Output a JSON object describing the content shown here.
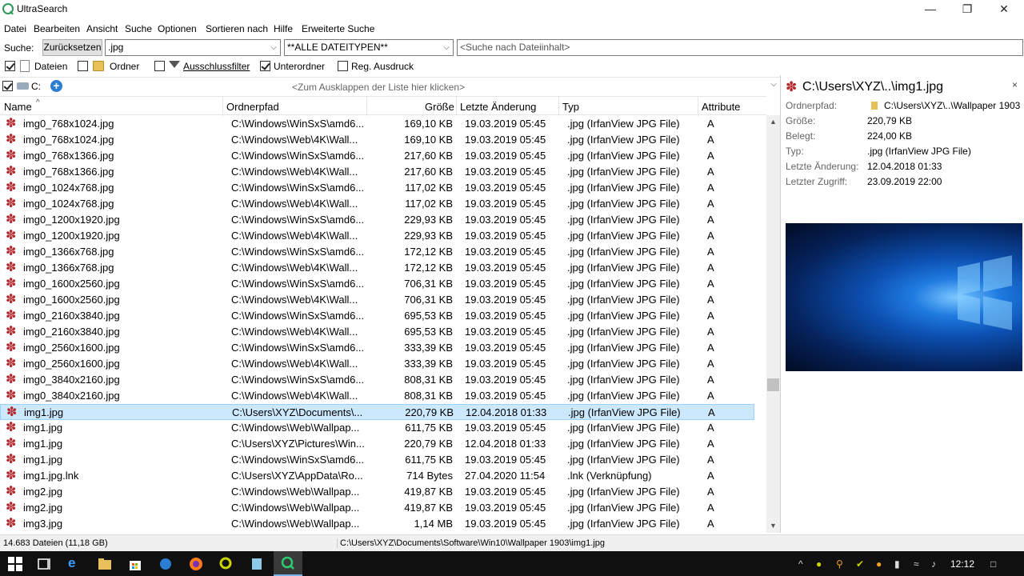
{
  "app": {
    "title": "UltraSearch"
  },
  "window_controls": {
    "minimize": "—",
    "maximize": "❐",
    "close": "✕"
  },
  "menu": [
    "Datei",
    "Bearbeiten",
    "Ansicht",
    "Suche",
    "Optionen",
    "Sortieren nach",
    "Hilfe",
    "Erweiterte Suche"
  ],
  "search": {
    "label": "Suche:",
    "reset_label": "Zurücksetzen",
    "query": ".jpg",
    "filetype": "**ALLE DATEITYPEN**",
    "content_placeholder": "<Suche nach Dateiinhalt>"
  },
  "options": {
    "files": {
      "label": "Dateien",
      "checked": true
    },
    "folders": {
      "label": "Ordner",
      "checked": false
    },
    "exclusion": {
      "label": "Ausschlussfilter",
      "checked": false
    },
    "subfolders": {
      "label": "Unterordner",
      "checked": true
    },
    "regex": {
      "label": "Reg. Ausdruck",
      "checked": false
    }
  },
  "drive": {
    "label": "C:",
    "expand_hint": "<Zum Ausklappen der Liste hier klicken>"
  },
  "columns": {
    "name": "Name",
    "path": "Ordnerpfad",
    "size": "Größe",
    "modified": "Letzte Änderung",
    "type": "Typ",
    "attributes": "Attribute"
  },
  "rows": [
    {
      "name": "img0_768x1024.jpg",
      "path": "C:\\Windows\\WinSxS\\amd6...",
      "size": "169,10 KB",
      "modified": "19.03.2019 05:45",
      "type": ".jpg (IrfanView JPG File)",
      "attr": "A"
    },
    {
      "name": "img0_768x1024.jpg",
      "path": "C:\\Windows\\Web\\4K\\Wall...",
      "size": "169,10 KB",
      "modified": "19.03.2019 05:45",
      "type": ".jpg (IrfanView JPG File)",
      "attr": "A"
    },
    {
      "name": "img0_768x1366.jpg",
      "path": "C:\\Windows\\WinSxS\\amd6...",
      "size": "217,60 KB",
      "modified": "19.03.2019 05:45",
      "type": ".jpg (IrfanView JPG File)",
      "attr": "A"
    },
    {
      "name": "img0_768x1366.jpg",
      "path": "C:\\Windows\\Web\\4K\\Wall...",
      "size": "217,60 KB",
      "modified": "19.03.2019 05:45",
      "type": ".jpg (IrfanView JPG File)",
      "attr": "A"
    },
    {
      "name": "img0_1024x768.jpg",
      "path": "C:\\Windows\\WinSxS\\amd6...",
      "size": "117,02 KB",
      "modified": "19.03.2019 05:45",
      "type": ".jpg (IrfanView JPG File)",
      "attr": "A"
    },
    {
      "name": "img0_1024x768.jpg",
      "path": "C:\\Windows\\Web\\4K\\Wall...",
      "size": "117,02 KB",
      "modified": "19.03.2019 05:45",
      "type": ".jpg (IrfanView JPG File)",
      "attr": "A"
    },
    {
      "name": "img0_1200x1920.jpg",
      "path": "C:\\Windows\\WinSxS\\amd6...",
      "size": "229,93 KB",
      "modified": "19.03.2019 05:45",
      "type": ".jpg (IrfanView JPG File)",
      "attr": "A"
    },
    {
      "name": "img0_1200x1920.jpg",
      "path": "C:\\Windows\\Web\\4K\\Wall...",
      "size": "229,93 KB",
      "modified": "19.03.2019 05:45",
      "type": ".jpg (IrfanView JPG File)",
      "attr": "A"
    },
    {
      "name": "img0_1366x768.jpg",
      "path": "C:\\Windows\\WinSxS\\amd6...",
      "size": "172,12 KB",
      "modified": "19.03.2019 05:45",
      "type": ".jpg (IrfanView JPG File)",
      "attr": "A"
    },
    {
      "name": "img0_1366x768.jpg",
      "path": "C:\\Windows\\Web\\4K\\Wall...",
      "size": "172,12 KB",
      "modified": "19.03.2019 05:45",
      "type": ".jpg (IrfanView JPG File)",
      "attr": "A"
    },
    {
      "name": "img0_1600x2560.jpg",
      "path": "C:\\Windows\\WinSxS\\amd6...",
      "size": "706,31 KB",
      "modified": "19.03.2019 05:45",
      "type": ".jpg (IrfanView JPG File)",
      "attr": "A"
    },
    {
      "name": "img0_1600x2560.jpg",
      "path": "C:\\Windows\\Web\\4K\\Wall...",
      "size": "706,31 KB",
      "modified": "19.03.2019 05:45",
      "type": ".jpg (IrfanView JPG File)",
      "attr": "A"
    },
    {
      "name": "img0_2160x3840.jpg",
      "path": "C:\\Windows\\WinSxS\\amd6...",
      "size": "695,53 KB",
      "modified": "19.03.2019 05:45",
      "type": ".jpg (IrfanView JPG File)",
      "attr": "A"
    },
    {
      "name": "img0_2160x3840.jpg",
      "path": "C:\\Windows\\Web\\4K\\Wall...",
      "size": "695,53 KB",
      "modified": "19.03.2019 05:45",
      "type": ".jpg (IrfanView JPG File)",
      "attr": "A"
    },
    {
      "name": "img0_2560x1600.jpg",
      "path": "C:\\Windows\\WinSxS\\amd6...",
      "size": "333,39 KB",
      "modified": "19.03.2019 05:45",
      "type": ".jpg (IrfanView JPG File)",
      "attr": "A"
    },
    {
      "name": "img0_2560x1600.jpg",
      "path": "C:\\Windows\\Web\\4K\\Wall...",
      "size": "333,39 KB",
      "modified": "19.03.2019 05:45",
      "type": ".jpg (IrfanView JPG File)",
      "attr": "A"
    },
    {
      "name": "img0_3840x2160.jpg",
      "path": "C:\\Windows\\WinSxS\\amd6...",
      "size": "808,31 KB",
      "modified": "19.03.2019 05:45",
      "type": ".jpg (IrfanView JPG File)",
      "attr": "A"
    },
    {
      "name": "img0_3840x2160.jpg",
      "path": "C:\\Windows\\Web\\4K\\Wall...",
      "size": "808,31 KB",
      "modified": "19.03.2019 05:45",
      "type": ".jpg (IrfanView JPG File)",
      "attr": "A"
    },
    {
      "name": "img1.jpg",
      "path": "C:\\Users\\XYZ\\Documents\\...",
      "size": "220,79 KB",
      "modified": "12.04.2018 01:33",
      "type": ".jpg (IrfanView JPG File)",
      "attr": "A",
      "selected": true
    },
    {
      "name": "img1.jpg",
      "path": "C:\\Windows\\Web\\Wallpap...",
      "size": "611,75 KB",
      "modified": "19.03.2019 05:45",
      "type": ".jpg (IrfanView JPG File)",
      "attr": "A"
    },
    {
      "name": "img1.jpg",
      "path": "C:\\Users\\XYZ\\Pictures\\Win...",
      "size": "220,79 KB",
      "modified": "12.04.2018 01:33",
      "type": ".jpg (IrfanView JPG File)",
      "attr": "A"
    },
    {
      "name": "img1.jpg",
      "path": "C:\\Windows\\WinSxS\\amd6...",
      "size": "611,75 KB",
      "modified": "19.03.2019 05:45",
      "type": ".jpg (IrfanView JPG File)",
      "attr": "A"
    },
    {
      "name": "img1.jpg.lnk",
      "path": "C:\\Users\\XYZ\\AppData\\Ro...",
      "size": "714 Bytes",
      "modified": "27.04.2020 11:54",
      "type": ".lnk (Verknüpfung)",
      "attr": "A"
    },
    {
      "name": "img2.jpg",
      "path": "C:\\Windows\\Web\\Wallpap...",
      "size": "419,87 KB",
      "modified": "19.03.2019 05:45",
      "type": ".jpg (IrfanView JPG File)",
      "attr": "A"
    },
    {
      "name": "img2.jpg",
      "path": "C:\\Windows\\Web\\Wallpap...",
      "size": "419,87 KB",
      "modified": "19.03.2019 05:45",
      "type": ".jpg (IrfanView JPG File)",
      "attr": "A"
    },
    {
      "name": "img3.jpg",
      "path": "C:\\Windows\\Web\\Wallpap...",
      "size": "1,14 MB",
      "modified": "19.03.2019 05:45",
      "type": ".jpg (IrfanView JPG File)",
      "attr": "A"
    }
  ],
  "scroll": {
    "position": 0.66
  },
  "preview": {
    "title": "C:\\Users\\XYZ\\..\\img1.jpg",
    "close": "×",
    "props": [
      {
        "label": "Ordnerpfad:",
        "value": "C:\\Users\\XYZ\\..\\Wallpaper 1903"
      },
      {
        "label": "Größe:",
        "value": "220,79 KB"
      },
      {
        "label": "Belegt:",
        "value": "224,00 KB"
      },
      {
        "label": "Typ:",
        "value": ".jpg (IrfanView JPG File)"
      },
      {
        "label": "Letzte Änderung:",
        "value": "12.04.2018 01:33"
      },
      {
        "label": "Letzter Zugriff:",
        "value": "23.09.2019 22:00"
      }
    ]
  },
  "status": {
    "count": "14.683 Dateien (11,18 GB)",
    "path": "C:\\Users\\XYZ\\Documents\\Software\\Win10\\Wallpaper 1903\\img1.jpg"
  },
  "taskbar": {
    "clock": "12:12"
  },
  "colors": {
    "selection": "#cce8ff",
    "accent": "#2b7cd3",
    "icon_red": "#b3262c"
  }
}
